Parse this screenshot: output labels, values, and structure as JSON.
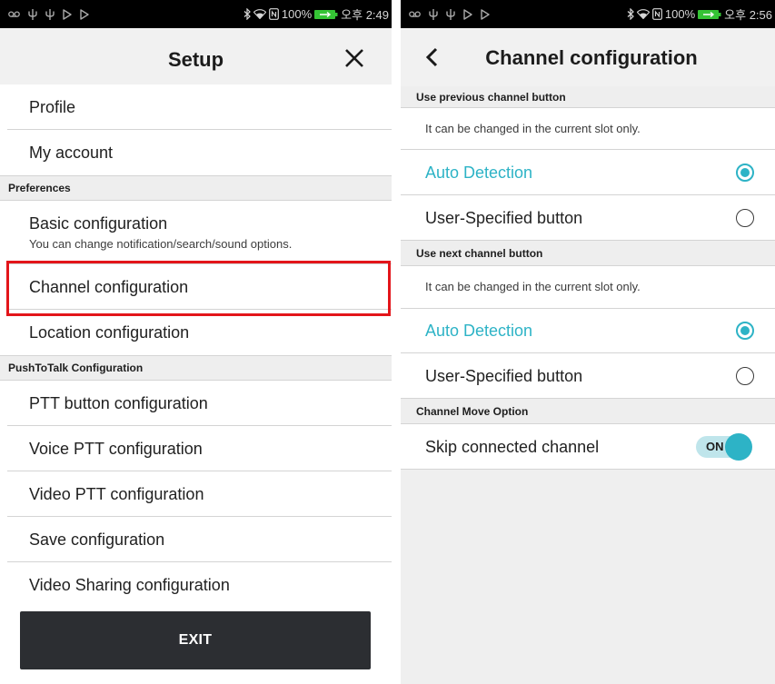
{
  "colors": {
    "accent": "#2db3c6",
    "highlight": "#e3151a",
    "exit_bg": "#2c2e32",
    "battery": "#35c435"
  },
  "left_screen": {
    "status_bar": {
      "left_icons": [
        "voicemail-icon",
        "usb-icon",
        "usb-icon",
        "play-store-icon",
        "play-store-icon"
      ],
      "right_icons": [
        "bluetooth-icon",
        "wifi-icon",
        "nfc-icon",
        "battery-charging-icon"
      ],
      "battery_percent": "100%",
      "time": "오후 2:49"
    },
    "header": {
      "title": "Setup",
      "close_icon": "close-icon"
    },
    "menu": {
      "top_items": [
        {
          "label": "Profile"
        },
        {
          "label": "My account"
        }
      ],
      "preferences": {
        "title": "Preferences",
        "items": [
          {
            "label": "Basic configuration",
            "subtitle": "You can change notification/search/sound options."
          },
          {
            "label": "Channel configuration",
            "highlighted": true
          },
          {
            "label": "Location configuration"
          }
        ]
      },
      "push_to_talk": {
        "title": "PushToTalk Configuration",
        "items": [
          {
            "label": "PTT button configuration"
          },
          {
            "label": "Voice PTT configuration"
          },
          {
            "label": "Video PTT configuration"
          },
          {
            "label": "Save configuration"
          },
          {
            "label": "Video Sharing configuration"
          }
        ]
      }
    },
    "exit_button": {
      "label": "EXIT"
    }
  },
  "right_screen": {
    "status_bar": {
      "left_icons": [
        "voicemail-icon",
        "usb-icon",
        "usb-icon",
        "play-store-icon",
        "play-store-icon"
      ],
      "right_icons": [
        "bluetooth-icon",
        "wifi-icon",
        "nfc-icon",
        "battery-charging-icon"
      ],
      "battery_percent": "100%",
      "time": "오후 2:56"
    },
    "header": {
      "title": "Channel configuration",
      "back_icon": "chevron-left-icon"
    },
    "previous_channel": {
      "title": "Use previous channel button",
      "note": "It can be changed in the current slot only.",
      "options": [
        {
          "label": "Auto Detection",
          "selected": true
        },
        {
          "label": "User-Specified button",
          "selected": false
        }
      ]
    },
    "next_channel": {
      "title": "Use next channel button",
      "note": "It can be changed in the current slot only.",
      "options": [
        {
          "label": "Auto Detection",
          "selected": true
        },
        {
          "label": "User-Specified button",
          "selected": false
        }
      ]
    },
    "channel_move": {
      "title": "Channel Move Option",
      "settings": [
        {
          "label": "Skip connected channel",
          "toggle_text": "ON",
          "enabled": true
        }
      ]
    }
  }
}
